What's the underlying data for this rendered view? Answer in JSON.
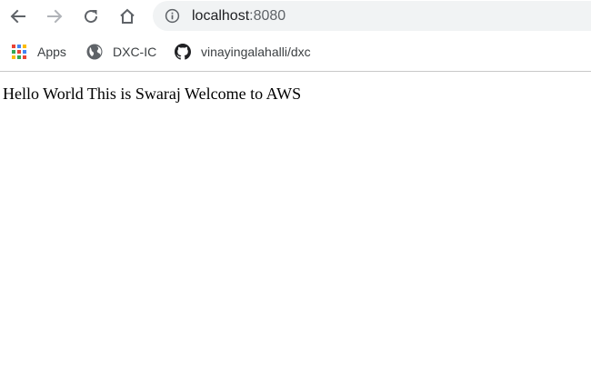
{
  "browser": {
    "url_host": "localhost",
    "url_port": ":8080",
    "icons": {
      "back": "arrow-left-icon",
      "forward": "arrow-right-icon",
      "reload": "reload-icon",
      "home": "home-icon",
      "site_info": "info-icon"
    }
  },
  "bookmarks": [
    {
      "label": "Apps",
      "icon": "apps-grid-icon"
    },
    {
      "label": "DXC-IC",
      "icon": "globe-icon"
    },
    {
      "label": "vinayingalahalli/dxc",
      "icon": "github-icon"
    }
  ],
  "page": {
    "text": "Hello World This is Swaraj Welcome to AWS"
  },
  "colors": {
    "omnibox_bg": "#f1f3f4",
    "nav_icon": "#5f6368",
    "nav_icon_disabled": "#b0b3b8"
  }
}
